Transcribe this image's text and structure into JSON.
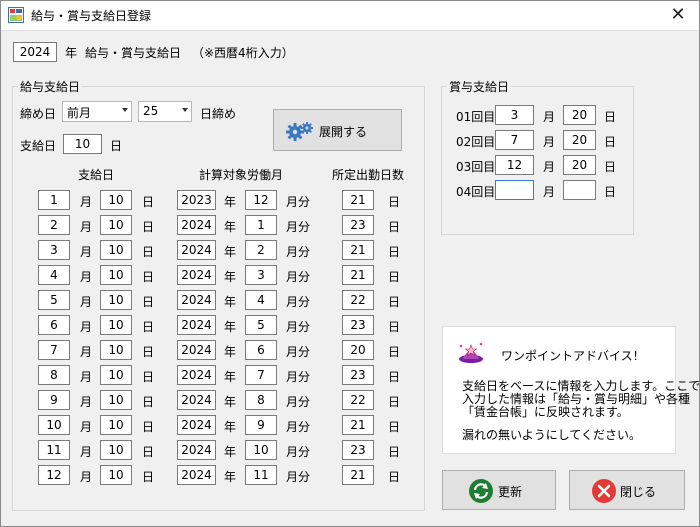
{
  "window": {
    "title": "給与・賞与支給日登録",
    "close_glyph": "✕"
  },
  "header": {
    "year": "2024",
    "year_unit": "年",
    "caption": "給与・賞与支給日",
    "note": "（※西暦4桁入力）"
  },
  "salary": {
    "group_title": "給与支給日",
    "cutoff_label": "締め日",
    "cutoff_month": "前月",
    "cutoff_day": "25",
    "cutoff_suffix": "日締め",
    "payday_label": "支給日",
    "payday_value": "10",
    "payday_unit": "日",
    "expand_button": "展開する",
    "col_payday": "支給日",
    "col_work_month": "計算対象労働月",
    "col_days": "所定出勤日数",
    "unit_month": "月",
    "unit_day": "日",
    "unit_year": "年",
    "unit_month_part": "月分",
    "rows": [
      {
        "month": "1",
        "day": "10",
        "wyear": "2023",
        "wmonth": "12",
        "days": "21"
      },
      {
        "month": "2",
        "day": "10",
        "wyear": "2024",
        "wmonth": "1",
        "days": "23"
      },
      {
        "month": "3",
        "day": "10",
        "wyear": "2024",
        "wmonth": "2",
        "days": "21"
      },
      {
        "month": "4",
        "day": "10",
        "wyear": "2024",
        "wmonth": "3",
        "days": "21"
      },
      {
        "month": "5",
        "day": "10",
        "wyear": "2024",
        "wmonth": "4",
        "days": "22"
      },
      {
        "month": "6",
        "day": "10",
        "wyear": "2024",
        "wmonth": "5",
        "days": "23"
      },
      {
        "month": "7",
        "day": "10",
        "wyear": "2024",
        "wmonth": "6",
        "days": "20"
      },
      {
        "month": "8",
        "day": "10",
        "wyear": "2024",
        "wmonth": "7",
        "days": "23"
      },
      {
        "month": "9",
        "day": "10",
        "wyear": "2024",
        "wmonth": "8",
        "days": "22"
      },
      {
        "month": "10",
        "day": "10",
        "wyear": "2024",
        "wmonth": "9",
        "days": "21"
      },
      {
        "month": "11",
        "day": "10",
        "wyear": "2024",
        "wmonth": "10",
        "days": "23"
      },
      {
        "month": "12",
        "day": "10",
        "wyear": "2024",
        "wmonth": "11",
        "days": "21"
      }
    ]
  },
  "bonus": {
    "group_title": "賞与支給日",
    "unit_month": "月",
    "unit_day": "日",
    "rows": [
      {
        "label": "01回目",
        "month": "3",
        "day": "20"
      },
      {
        "label": "02回目",
        "month": "7",
        "day": "20"
      },
      {
        "label": "03回目",
        "month": "12",
        "day": "20"
      },
      {
        "label": "04回目",
        "month": "",
        "day": ""
      }
    ]
  },
  "advice": {
    "title": "ワンポイントアドバイス！",
    "line1": "支給日をベースに情報を入力します。ここで",
    "line2": "入力した情報は「給与・賞与明細」や各種",
    "line3": "「賃金台帳」に反映されます。",
    "line4": "漏れの無いようにしてください。"
  },
  "buttons": {
    "update": "更新",
    "close": "閉じる"
  },
  "colors": {
    "update_icon": "#1e7d32",
    "close_icon": "#e53935",
    "focus_border": "#2e7dd7",
    "advice_icon": "#c2185b"
  }
}
